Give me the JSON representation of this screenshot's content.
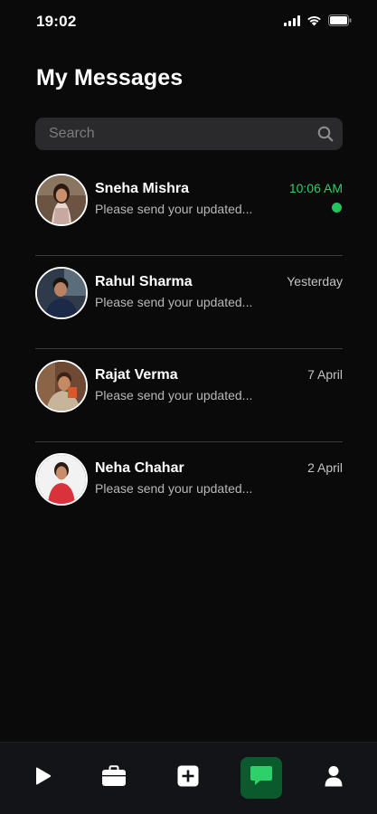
{
  "status_bar": {
    "time": "19:02",
    "icons": [
      "signal-icon",
      "wifi-icon",
      "battery-icon"
    ]
  },
  "page": {
    "title": "My Messages"
  },
  "search": {
    "placeholder": "Search",
    "icon": "search-icon"
  },
  "messages": [
    {
      "name": "Sneha Mishra",
      "preview": "Please send your updated...",
      "time": "10:06 AM",
      "unread": true
    },
    {
      "name": "Rahul Sharma",
      "preview": "Please send your updated...",
      "time": "Yesterday",
      "unread": false
    },
    {
      "name": "Rajat Verma",
      "preview": "Please send your updated...",
      "time": "7 April",
      "unread": false
    },
    {
      "name": "Neha Chahar",
      "preview": "Please send your updated...",
      "time": "2 April",
      "unread": false
    }
  ],
  "bottom_nav": {
    "items": [
      {
        "icon": "play-icon",
        "active": false
      },
      {
        "icon": "briefcase-icon",
        "active": false
      },
      {
        "icon": "add-icon",
        "active": false
      },
      {
        "icon": "chat-icon",
        "active": true
      },
      {
        "icon": "profile-icon",
        "active": false
      }
    ]
  },
  "colors": {
    "background": "#0a0a0a",
    "accent_green": "#2fcf6a",
    "active_nav_bg": "#0b5a2e",
    "search_bg": "#2a2a2c",
    "divider": "#3a3a3c"
  }
}
